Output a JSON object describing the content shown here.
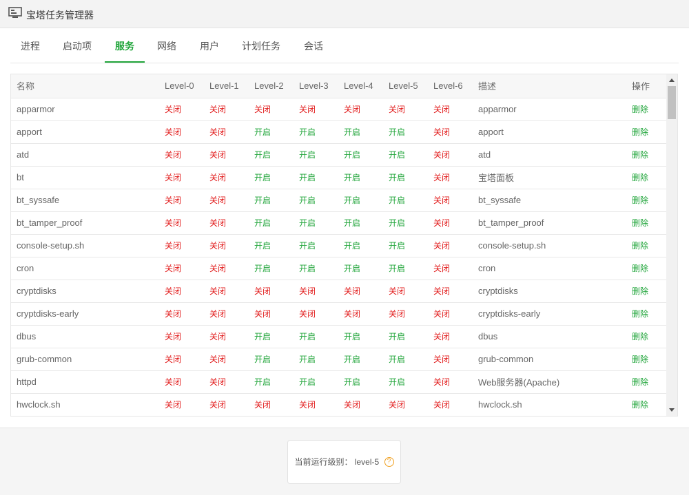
{
  "window": {
    "title": "宝塔任务管理器",
    "icon": "computer-monitor-icon"
  },
  "tabs": [
    {
      "label": "进程"
    },
    {
      "label": "启动项"
    },
    {
      "label": "服务",
      "active": true
    },
    {
      "label": "网络"
    },
    {
      "label": "用户"
    },
    {
      "label": "计划任务"
    },
    {
      "label": "会话"
    }
  ],
  "table": {
    "headers": [
      "名称",
      "Level-0",
      "Level-1",
      "Level-2",
      "Level-3",
      "Level-4",
      "Level-5",
      "Level-6",
      "描述",
      "操作"
    ],
    "on_label": "开启",
    "off_label": "关闭",
    "delete_label": "删除",
    "rows": [
      {
        "name": "apparmor",
        "levels": [
          0,
          0,
          0,
          0,
          0,
          0,
          0
        ],
        "desc": "apparmor"
      },
      {
        "name": "apport",
        "levels": [
          0,
          0,
          1,
          1,
          1,
          1,
          0
        ],
        "desc": "apport"
      },
      {
        "name": "atd",
        "levels": [
          0,
          0,
          1,
          1,
          1,
          1,
          0
        ],
        "desc": "atd"
      },
      {
        "name": "bt",
        "levels": [
          0,
          0,
          1,
          1,
          1,
          1,
          0
        ],
        "desc": "宝塔面板"
      },
      {
        "name": "bt_syssafe",
        "levels": [
          0,
          0,
          1,
          1,
          1,
          1,
          0
        ],
        "desc": "bt_syssafe"
      },
      {
        "name": "bt_tamper_proof",
        "levels": [
          0,
          0,
          1,
          1,
          1,
          1,
          0
        ],
        "desc": "bt_tamper_proof"
      },
      {
        "name": "console-setup.sh",
        "levels": [
          0,
          0,
          1,
          1,
          1,
          1,
          0
        ],
        "desc": "console-setup.sh"
      },
      {
        "name": "cron",
        "levels": [
          0,
          0,
          1,
          1,
          1,
          1,
          0
        ],
        "desc": "cron"
      },
      {
        "name": "cryptdisks",
        "levels": [
          0,
          0,
          0,
          0,
          0,
          0,
          0
        ],
        "desc": "cryptdisks"
      },
      {
        "name": "cryptdisks-early",
        "levels": [
          0,
          0,
          0,
          0,
          0,
          0,
          0
        ],
        "desc": "cryptdisks-early"
      },
      {
        "name": "dbus",
        "levels": [
          0,
          0,
          1,
          1,
          1,
          1,
          0
        ],
        "desc": "dbus"
      },
      {
        "name": "grub-common",
        "levels": [
          0,
          0,
          1,
          1,
          1,
          1,
          0
        ],
        "desc": "grub-common"
      },
      {
        "name": "httpd",
        "levels": [
          0,
          0,
          1,
          1,
          1,
          1,
          0
        ],
        "desc": "Web服务器(Apache)"
      },
      {
        "name": "hwclock.sh",
        "levels": [
          0,
          0,
          0,
          0,
          0,
          0,
          0
        ],
        "desc": "hwclock.sh"
      }
    ]
  },
  "status": {
    "label": "当前运行级别：",
    "value": "level-5",
    "help_icon": "question-circle-icon"
  },
  "colors": {
    "accent": "#20a53a",
    "on": "#20a53a",
    "off": "#e21b1b",
    "warning": "#f0a020"
  }
}
